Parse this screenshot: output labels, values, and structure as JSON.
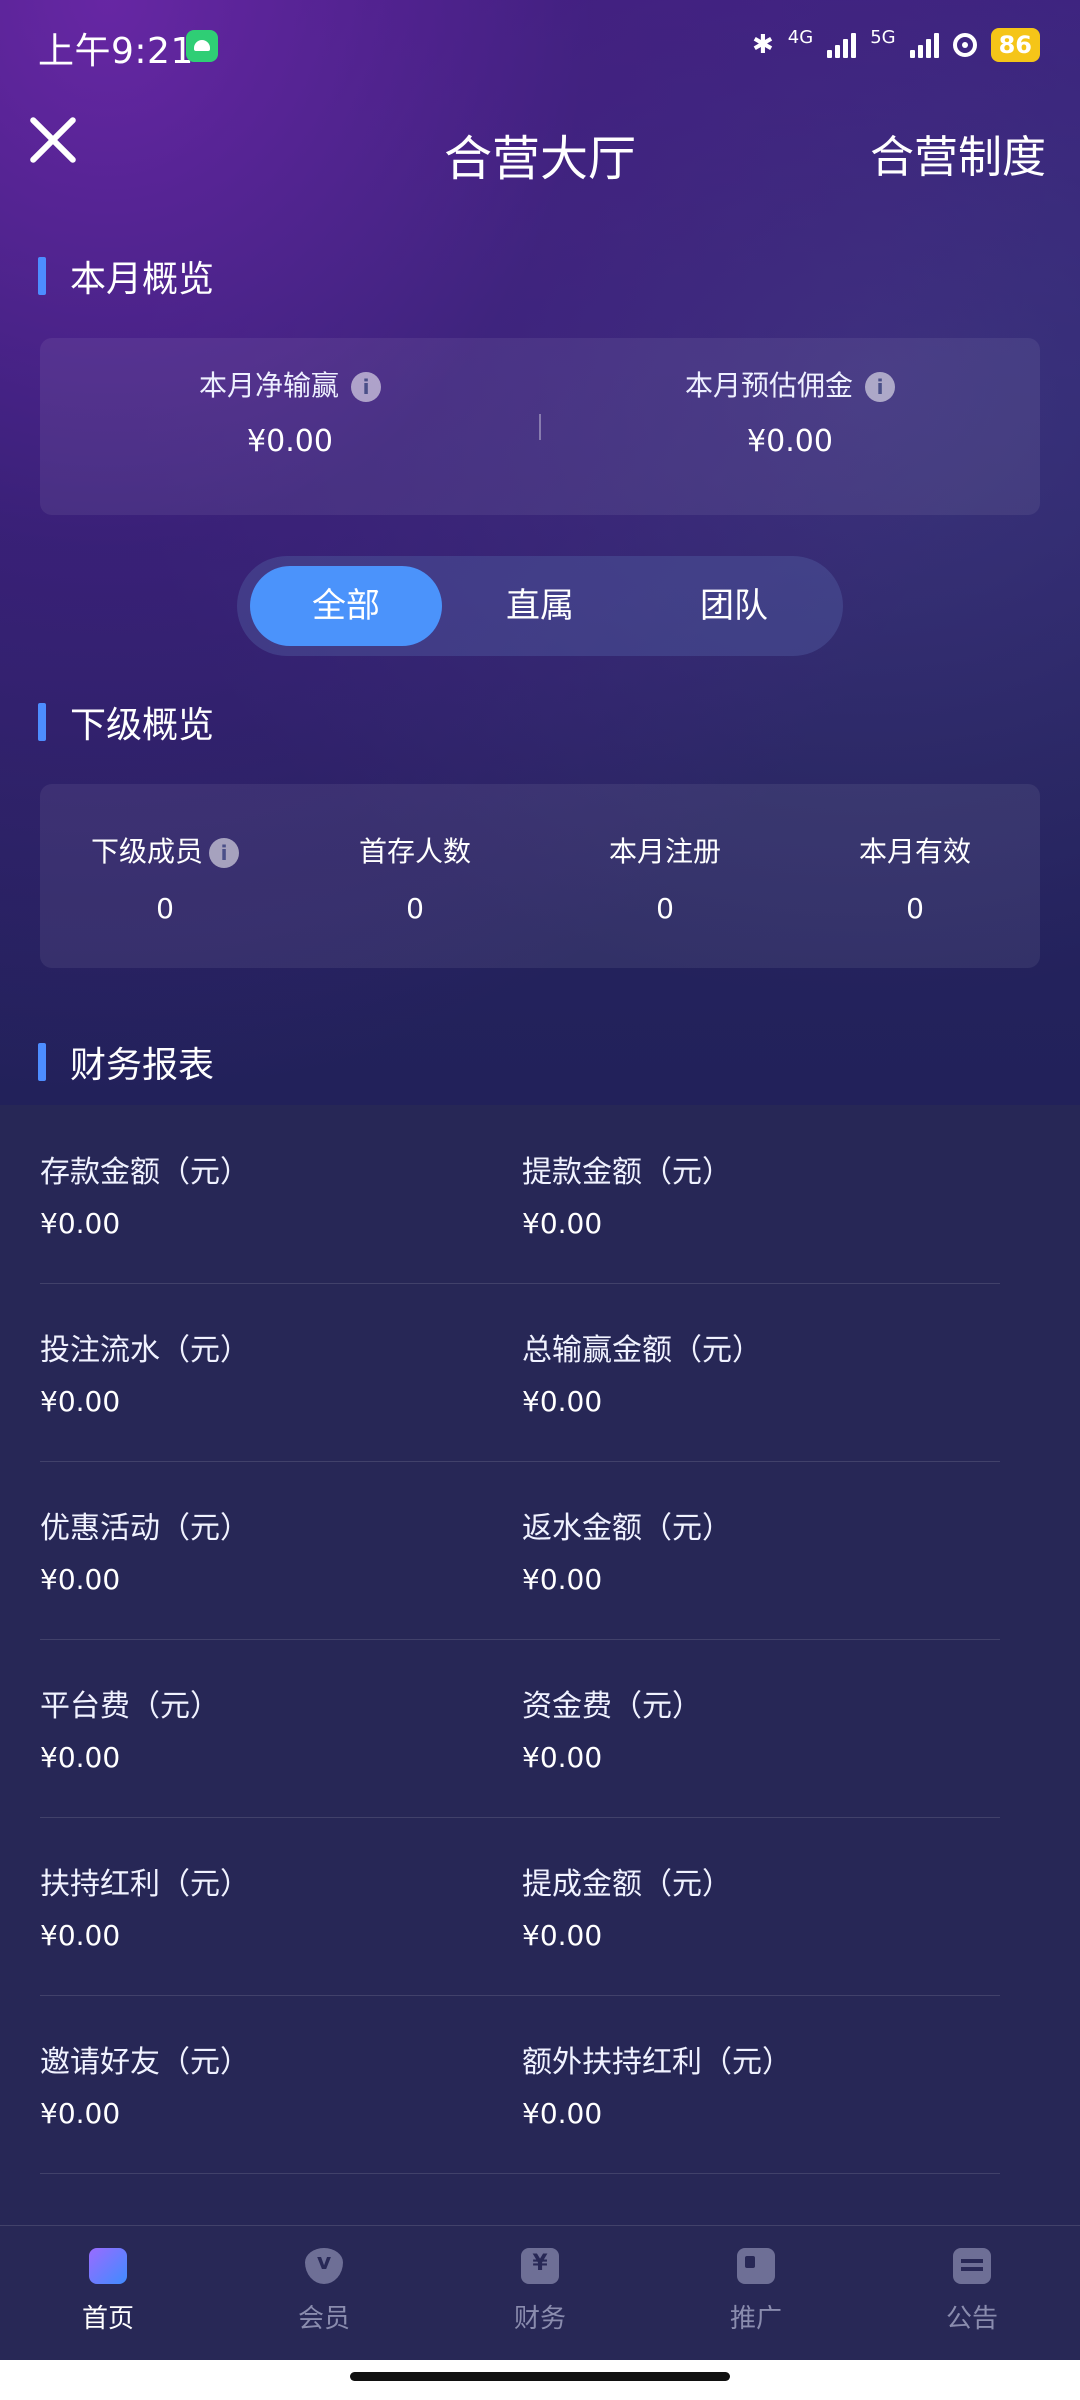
{
  "status_bar": {
    "time": "上午9:21",
    "network_1": "4G",
    "network_2": "5G",
    "battery": "86"
  },
  "nav": {
    "title": "合营大厅",
    "right_link": "合营制度"
  },
  "month_overview": {
    "title": "本月概览",
    "net_win_label": "本月净输赢",
    "net_win_value": "¥0.00",
    "commission_label": "本月预估佣金",
    "commission_value": "¥0.00"
  },
  "segment": {
    "options": [
      "全部",
      "直属",
      "团队"
    ],
    "selected": "全部"
  },
  "sub_overview": {
    "title": "下级概览",
    "items": [
      {
        "label": "下级成员",
        "value": "0"
      },
      {
        "label": "首存人数",
        "value": "0"
      },
      {
        "label": "本月注册",
        "value": "0"
      },
      {
        "label": "本月有效",
        "value": "0"
      }
    ]
  },
  "finance_report": {
    "title": "财务报表",
    "rows": [
      [
        {
          "label": "存款金额（元）",
          "value": "¥0.00"
        },
        {
          "label": "提款金额（元）",
          "value": "¥0.00"
        }
      ],
      [
        {
          "label": "投注流水（元）",
          "value": "¥0.00"
        },
        {
          "label": "总输赢金额（元）",
          "value": "¥0.00"
        }
      ],
      [
        {
          "label": "优惠活动（元）",
          "value": "¥0.00"
        },
        {
          "label": "返水金额（元）",
          "value": "¥0.00"
        }
      ],
      [
        {
          "label": "平台费（元）",
          "value": "¥0.00"
        },
        {
          "label": "资金费（元）",
          "value": "¥0.00"
        }
      ],
      [
        {
          "label": "扶持红利（元）",
          "value": "¥0.00"
        },
        {
          "label": "提成金额（元）",
          "value": "¥0.00"
        }
      ],
      [
        {
          "label": "邀请好友（元）",
          "value": "¥0.00"
        },
        {
          "label": "额外扶持红利（元）",
          "value": "¥0.00"
        }
      ]
    ]
  },
  "tabbar": {
    "items": [
      {
        "label": "首页",
        "icon": "home-icon"
      },
      {
        "label": "会员",
        "icon": "vip-icon"
      },
      {
        "label": "财务",
        "icon": "finance-icon"
      },
      {
        "label": "推广",
        "icon": "promotion-icon"
      },
      {
        "label": "公告",
        "icon": "notice-icon"
      }
    ],
    "active": "首页"
  },
  "colors": {
    "accent": "#4b93fb",
    "background": "#272756",
    "battery": "#f5c518"
  }
}
